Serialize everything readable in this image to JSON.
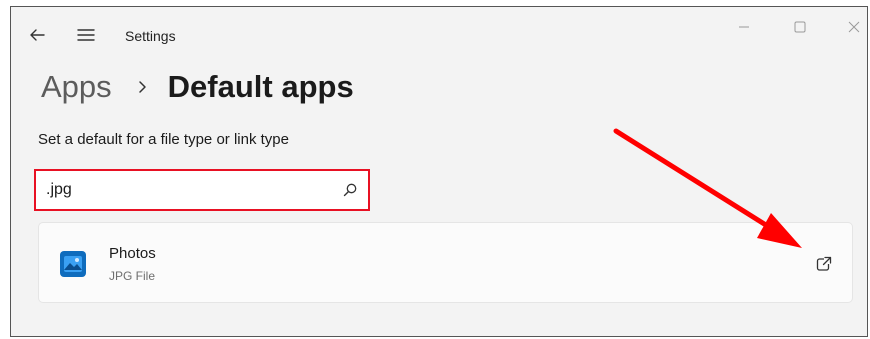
{
  "window": {
    "title": "Settings"
  },
  "breadcrumb": {
    "parent": "Apps",
    "current": "Default apps"
  },
  "section": {
    "label": "Set a default for a file type or link type"
  },
  "search": {
    "value": ".jpg",
    "placeholder": ""
  },
  "result": {
    "app_name": "Photos",
    "file_type": "JPG File"
  },
  "icons": {
    "back": "back-arrow-icon",
    "menu": "hamburger-menu-icon",
    "minimize": "minimize-icon",
    "maximize": "maximize-icon",
    "close": "close-icon",
    "separator": "chevron-right-icon",
    "search": "search-icon",
    "app": "photos-app-icon",
    "open": "open-external-icon"
  },
  "colors": {
    "highlight": "#e81123",
    "annotation_arrow": "#ff0000",
    "photos_icon": "#0f6cbd"
  }
}
